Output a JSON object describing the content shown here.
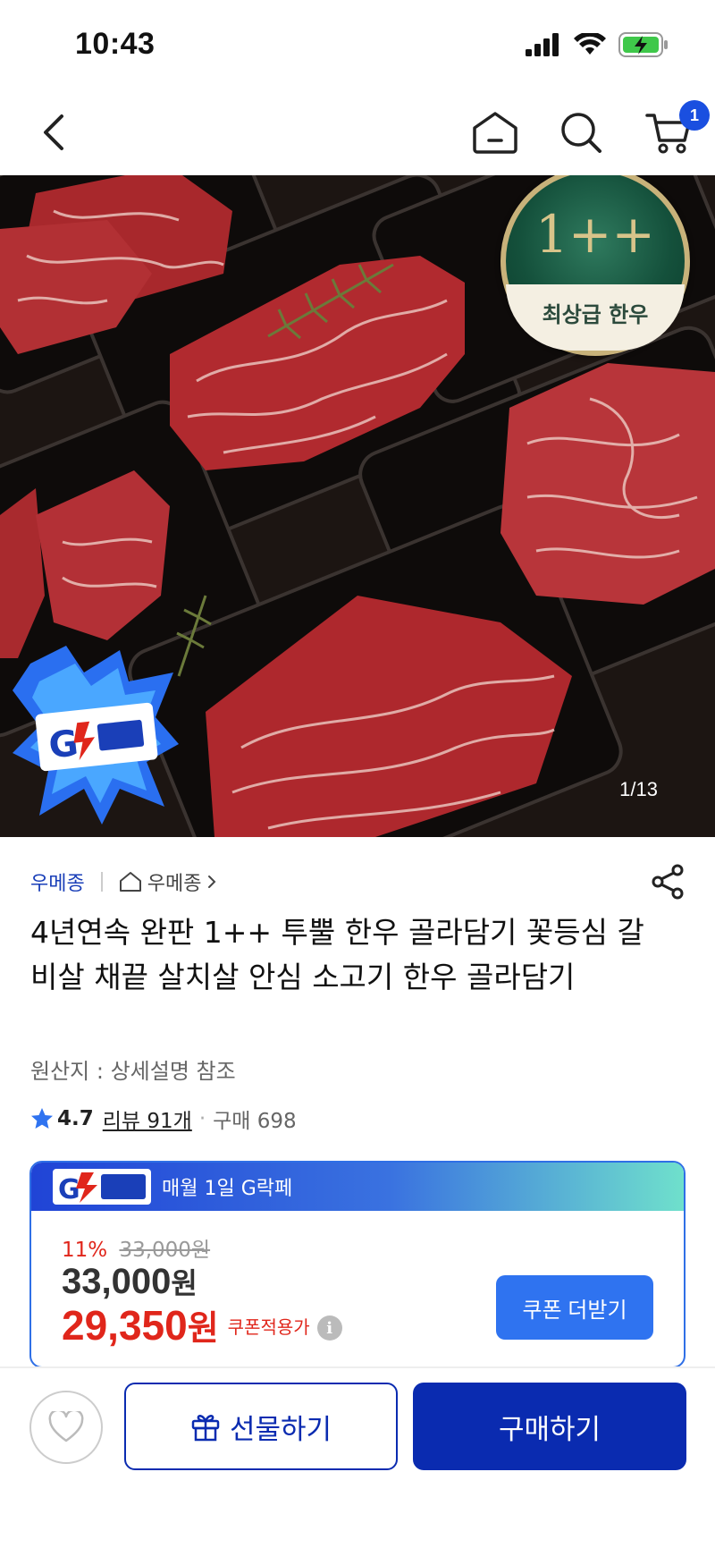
{
  "status_bar": {
    "time": "10:43"
  },
  "nav": {
    "cart_count": "1"
  },
  "hero": {
    "image_counter": "1/13",
    "grade_badge_top": "1++",
    "grade_badge_bottom": "최상급 한우"
  },
  "product": {
    "seller": "우메종",
    "store": "우메종",
    "title": "4년연속 완판 1++ 투뿔 한우 골라담기 꽃등심 갈비살 채끝 살치살 안심 소고기 한우 골라담기",
    "origin": "원산지 : 상세설명 참조",
    "rating": "4.7",
    "review_label": "리뷰 91개",
    "purchase_label": "구매 698"
  },
  "promo": {
    "header_text": "매월 1일 G락페",
    "discount_rate": "11%",
    "original_price": "33,000원",
    "base_price_number": "33,000",
    "price_unit": "원",
    "coupon_price_number": "29,350",
    "coupon_label": "쿠폰적용가",
    "coupon_button": "쿠폰 더받기"
  },
  "actions": {
    "gift_label": "선물하기",
    "buy_label": "구매하기"
  },
  "colors": {
    "accent": "#0a2bb0",
    "sale_red": "#e0261b",
    "coupon_blue": "#2f73f0"
  }
}
